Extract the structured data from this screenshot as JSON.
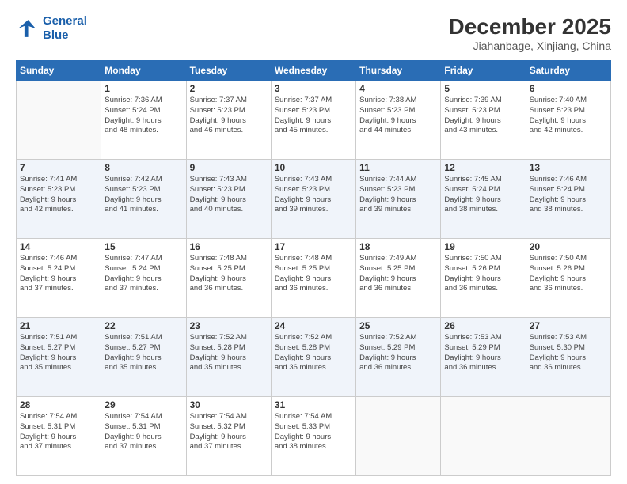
{
  "logo": {
    "line1": "General",
    "line2": "Blue"
  },
  "title": "December 2025",
  "location": "Jiahanbage, Xinjiang, China",
  "days_of_week": [
    "Sunday",
    "Monday",
    "Tuesday",
    "Wednesday",
    "Thursday",
    "Friday",
    "Saturday"
  ],
  "weeks": [
    [
      {
        "day": "",
        "sunrise": "",
        "sunset": "",
        "daylight": "",
        "empty": true
      },
      {
        "day": "1",
        "sunrise": "7:36 AM",
        "sunset": "5:24 PM",
        "hours": "9",
        "minutes": "48"
      },
      {
        "day": "2",
        "sunrise": "7:37 AM",
        "sunset": "5:23 PM",
        "hours": "9",
        "minutes": "46"
      },
      {
        "day": "3",
        "sunrise": "7:37 AM",
        "sunset": "5:23 PM",
        "hours": "9",
        "minutes": "45"
      },
      {
        "day": "4",
        "sunrise": "7:38 AM",
        "sunset": "5:23 PM",
        "hours": "9",
        "minutes": "44"
      },
      {
        "day": "5",
        "sunrise": "7:39 AM",
        "sunset": "5:23 PM",
        "hours": "9",
        "minutes": "43"
      },
      {
        "day": "6",
        "sunrise": "7:40 AM",
        "sunset": "5:23 PM",
        "hours": "9",
        "minutes": "42"
      }
    ],
    [
      {
        "day": "7",
        "sunrise": "7:41 AM",
        "sunset": "5:23 PM",
        "hours": "9",
        "minutes": "42"
      },
      {
        "day": "8",
        "sunrise": "7:42 AM",
        "sunset": "5:23 PM",
        "hours": "9",
        "minutes": "41"
      },
      {
        "day": "9",
        "sunrise": "7:43 AM",
        "sunset": "5:23 PM",
        "hours": "9",
        "minutes": "40"
      },
      {
        "day": "10",
        "sunrise": "7:43 AM",
        "sunset": "5:23 PM",
        "hours": "9",
        "minutes": "39"
      },
      {
        "day": "11",
        "sunrise": "7:44 AM",
        "sunset": "5:23 PM",
        "hours": "9",
        "minutes": "39"
      },
      {
        "day": "12",
        "sunrise": "7:45 AM",
        "sunset": "5:24 PM",
        "hours": "9",
        "minutes": "38"
      },
      {
        "day": "13",
        "sunrise": "7:46 AM",
        "sunset": "5:24 PM",
        "hours": "9",
        "minutes": "38"
      }
    ],
    [
      {
        "day": "14",
        "sunrise": "7:46 AM",
        "sunset": "5:24 PM",
        "hours": "9",
        "minutes": "37"
      },
      {
        "day": "15",
        "sunrise": "7:47 AM",
        "sunset": "5:24 PM",
        "hours": "9",
        "minutes": "37"
      },
      {
        "day": "16",
        "sunrise": "7:48 AM",
        "sunset": "5:25 PM",
        "hours": "9",
        "minutes": "36"
      },
      {
        "day": "17",
        "sunrise": "7:48 AM",
        "sunset": "5:25 PM",
        "hours": "9",
        "minutes": "36"
      },
      {
        "day": "18",
        "sunrise": "7:49 AM",
        "sunset": "5:25 PM",
        "hours": "9",
        "minutes": "36"
      },
      {
        "day": "19",
        "sunrise": "7:50 AM",
        "sunset": "5:26 PM",
        "hours": "9",
        "minutes": "36"
      },
      {
        "day": "20",
        "sunrise": "7:50 AM",
        "sunset": "5:26 PM",
        "hours": "9",
        "minutes": "36"
      }
    ],
    [
      {
        "day": "21",
        "sunrise": "7:51 AM",
        "sunset": "5:27 PM",
        "hours": "9",
        "minutes": "35"
      },
      {
        "day": "22",
        "sunrise": "7:51 AM",
        "sunset": "5:27 PM",
        "hours": "9",
        "minutes": "35"
      },
      {
        "day": "23",
        "sunrise": "7:52 AM",
        "sunset": "5:28 PM",
        "hours": "9",
        "minutes": "35"
      },
      {
        "day": "24",
        "sunrise": "7:52 AM",
        "sunset": "5:28 PM",
        "hours": "9",
        "minutes": "36"
      },
      {
        "day": "25",
        "sunrise": "7:52 AM",
        "sunset": "5:29 PM",
        "hours": "9",
        "minutes": "36"
      },
      {
        "day": "26",
        "sunrise": "7:53 AM",
        "sunset": "5:29 PM",
        "hours": "9",
        "minutes": "36"
      },
      {
        "day": "27",
        "sunrise": "7:53 AM",
        "sunset": "5:30 PM",
        "hours": "9",
        "minutes": "36"
      }
    ],
    [
      {
        "day": "28",
        "sunrise": "7:54 AM",
        "sunset": "5:31 PM",
        "hours": "9",
        "minutes": "37"
      },
      {
        "day": "29",
        "sunrise": "7:54 AM",
        "sunset": "5:31 PM",
        "hours": "9",
        "minutes": "37"
      },
      {
        "day": "30",
        "sunrise": "7:54 AM",
        "sunset": "5:32 PM",
        "hours": "9",
        "minutes": "37"
      },
      {
        "day": "31",
        "sunrise": "7:54 AM",
        "sunset": "5:33 PM",
        "hours": "9",
        "minutes": "38"
      },
      {
        "day": "",
        "sunrise": "",
        "sunset": "",
        "hours": "",
        "minutes": "",
        "empty": true
      },
      {
        "day": "",
        "sunrise": "",
        "sunset": "",
        "hours": "",
        "minutes": "",
        "empty": true
      },
      {
        "day": "",
        "sunrise": "",
        "sunset": "",
        "hours": "",
        "minutes": "",
        "empty": true
      }
    ]
  ]
}
